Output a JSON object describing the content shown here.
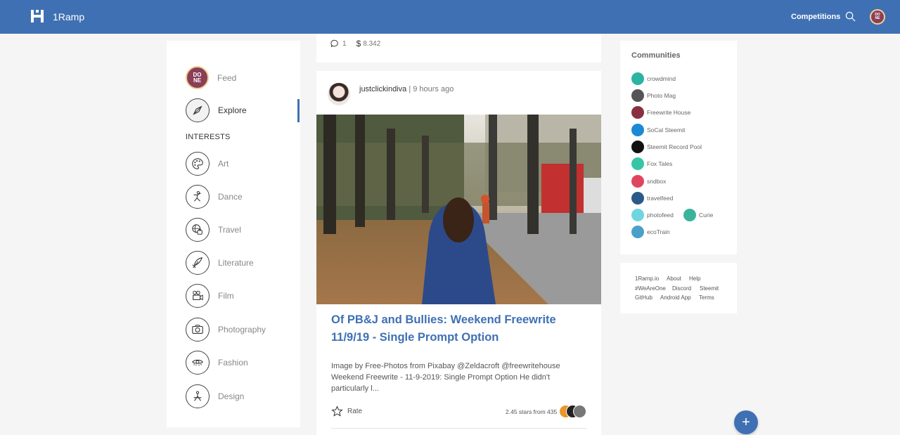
{
  "header": {
    "brand": "1Ramp",
    "competitions_label": "Competitions",
    "avatar_text_top": "DO",
    "avatar_text_bottom": "NE"
  },
  "sidebar": {
    "items": [
      {
        "label": "Feed",
        "icon": "done-badge-icon"
      },
      {
        "label": "Explore",
        "icon": "compass-icon",
        "active": true
      }
    ],
    "interests_title": "INTERESTS",
    "interests": [
      {
        "label": "Art",
        "icon": "palette-icon"
      },
      {
        "label": "Dance",
        "icon": "dancer-icon"
      },
      {
        "label": "Travel",
        "icon": "globe-luggage-icon"
      },
      {
        "label": "Literature",
        "icon": "quill-icon"
      },
      {
        "label": "Film",
        "icon": "film-camera-icon"
      },
      {
        "label": "Photography",
        "icon": "camera-icon"
      },
      {
        "label": "Fashion",
        "icon": "eye-icon"
      },
      {
        "label": "Design",
        "icon": "compass-drafting-icon"
      }
    ]
  },
  "prev_card": {
    "comments": "1",
    "payout": "8.342"
  },
  "post": {
    "author": "justclickindiva",
    "separator": "|",
    "time": "9 hours ago",
    "title": "Of PB&J and Bullies: Weekend Freewrite 11/9/19 - Single Prompt Option",
    "excerpt": "Image by Free-Photos from Pixabay @Zeldacroft @freewritehouse Weekend Freewrite - 11-9-2019: Single Prompt Option He didn't particularly l...",
    "rate_label": "Rate",
    "stars_info": "2.45 stars from 435"
  },
  "communities": {
    "title": "Communities",
    "items": [
      {
        "name": "crowdmind",
        "color": "#2bb3a3"
      },
      {
        "name": "Photo Mag",
        "color": "#555555"
      },
      {
        "name": "Freewrite House",
        "color": "#8a2f3f"
      },
      {
        "name": "SoCal Steemit",
        "color": "#1a8ad4"
      },
      {
        "name": "Steemit Record Pool",
        "color": "#111111"
      },
      {
        "name": "Fox Tales",
        "color": "#35c7a5"
      },
      {
        "name": "sndbox",
        "color": "#e0455f"
      },
      {
        "name": "travelfeed",
        "color": "#2a5a8a"
      },
      {
        "name": "photofeed",
        "color": "#6fd6e0"
      },
      {
        "name": "Curie",
        "color": "#3ab39a"
      },
      {
        "name": "ecoTrain",
        "color": "#4aa0c8"
      }
    ]
  },
  "footer": {
    "links": [
      "1Ramp.io",
      "About",
      "Help",
      "#WeAreOne",
      "Discord",
      "Steemit",
      "GitHub",
      "Android App",
      "Terms"
    ]
  },
  "fab_label": "+",
  "colors": {
    "accent": "#3f70b3",
    "header_bg": "#3f70b3"
  }
}
